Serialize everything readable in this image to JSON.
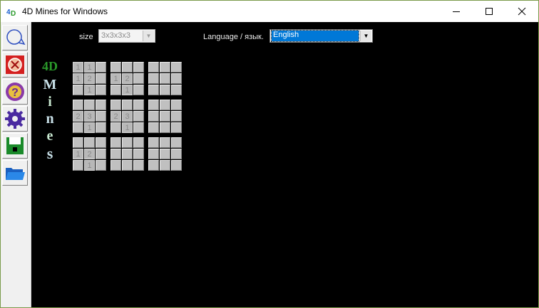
{
  "window": {
    "title": "4D Mines for Windows",
    "app_icon_text": "4D"
  },
  "toolbar": {
    "buttons": [
      {
        "name": "new-game-icon"
      },
      {
        "name": "stop-icon"
      },
      {
        "name": "help-icon"
      },
      {
        "name": "settings-icon"
      },
      {
        "name": "save-icon"
      },
      {
        "name": "open-folder-icon"
      }
    ]
  },
  "controls": {
    "size_label": "size",
    "size_value": "3x3x3x3",
    "language_label": "Language / язык.",
    "language_value": "English"
  },
  "logo": {
    "letters": [
      "4D",
      "M",
      "i",
      "n",
      "e",
      "s"
    ]
  },
  "boards": [
    [
      [
        "1",
        "1",
        ""
      ],
      [
        "1",
        "2",
        ""
      ],
      [
        "",
        "1",
        ""
      ]
    ],
    [
      [
        "",
        "",
        ""
      ],
      [
        "1",
        "2",
        ""
      ],
      [
        "",
        "1",
        ""
      ]
    ],
    [
      [
        "",
        "",
        ""
      ],
      [
        "",
        "",
        ""
      ],
      [
        "",
        "",
        ""
      ]
    ],
    [
      [
        "",
        "",
        ""
      ],
      [
        "2",
        "3",
        ""
      ],
      [
        "",
        "1",
        ""
      ]
    ],
    [
      [
        "",
        "",
        ""
      ],
      [
        "2",
        "3",
        ""
      ],
      [
        "",
        "1",
        ""
      ]
    ],
    [
      [
        "",
        "",
        ""
      ],
      [
        "",
        "",
        ""
      ],
      [
        "",
        "",
        ""
      ]
    ],
    [
      [
        "",
        "",
        ""
      ],
      [
        "1",
        "2",
        ""
      ],
      [
        "",
        "1",
        ""
      ]
    ],
    [
      [
        "",
        "",
        ""
      ],
      [
        "",
        "",
        ""
      ],
      [
        "",
        "",
        ""
      ]
    ],
    [
      [
        "",
        "",
        ""
      ],
      [
        "",
        "",
        ""
      ],
      [
        "",
        "",
        ""
      ]
    ]
  ]
}
